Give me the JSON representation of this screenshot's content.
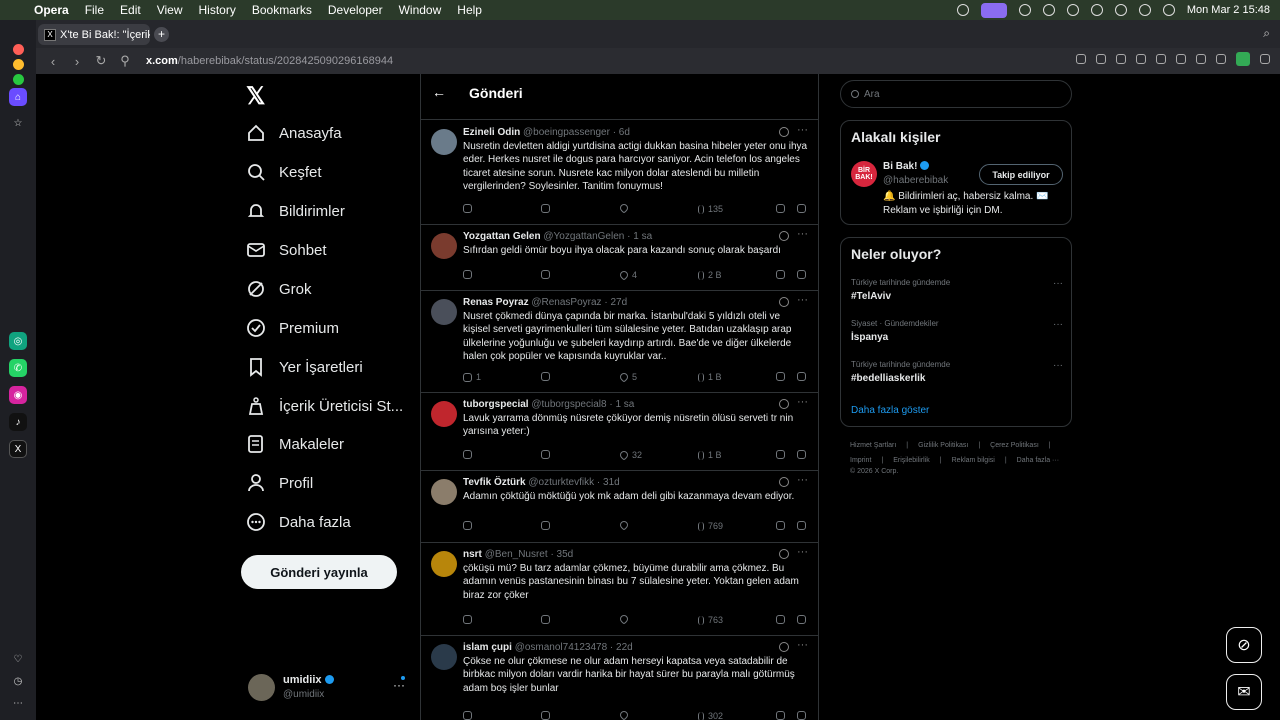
{
  "menubar": {
    "app": "Opera",
    "items": [
      "File",
      "Edit",
      "View",
      "History",
      "Bookmarks",
      "Developer",
      "Window",
      "Help"
    ],
    "datetime": "Mon Mar 2  15:48"
  },
  "browser": {
    "tab_title": "X'te Bi Bak!: \"İçerik Üret",
    "url_host": "x.com",
    "url_path": "/haberebibak/status/2028425090296168944"
  },
  "nav": {
    "items": [
      {
        "label": "Anasayfa",
        "icon": "home-icon"
      },
      {
        "label": "Keşfet",
        "icon": "search-icon"
      },
      {
        "label": "Bildirimler",
        "icon": "bell-icon"
      },
      {
        "label": "Sohbet",
        "icon": "mail-icon"
      },
      {
        "label": "Grok",
        "icon": "grok-icon"
      },
      {
        "label": "Premium",
        "icon": "verified-icon"
      },
      {
        "label": "Yer İşaretleri",
        "icon": "bookmark-icon"
      },
      {
        "label": "İçerik Üreticisi St...",
        "icon": "creator-icon"
      },
      {
        "label": "Makaleler",
        "icon": "article-icon"
      },
      {
        "label": "Profil",
        "icon": "profile-icon"
      },
      {
        "label": "Daha fazla",
        "icon": "more-circle-icon"
      }
    ],
    "post_button": "Gönderi yayınla",
    "account": {
      "name": "umidiix",
      "handle": "@umidiix"
    }
  },
  "feed": {
    "title": "Gönderi",
    "tweets": [
      {
        "name": "Ezineli Odin",
        "handle": "@boeingpassenger",
        "time": "· 6d",
        "avatar": "#6a7b8a",
        "text": "Nusretin devletten aldigi yurtdisina actigi dukkan basina hibeler yeter onu ihya eder. Herkes nusret ile dogus para harcıyor saniyor. Acin telefon los angeles ticaret atesine sorun. Nusrete kac milyon dolar ateslendi bu milletin vergilerinden? Soylesinler. Tanitim fonuymus!",
        "replies": "",
        "retweets": "",
        "likes": "",
        "views": "135"
      },
      {
        "name": "Yozgattan Gelen",
        "handle": "@YozgattanGelen",
        "time": "· 1 sa",
        "avatar": "#7a3b2e",
        "text": "Sıfırdan geldi ömür boyu ihya olacak para kazandı sonuç olarak başardı",
        "replies": "",
        "retweets": "",
        "likes": "4",
        "views": "2 B"
      },
      {
        "name": "Renas Poyraz",
        "handle": "@RenasPoyraz",
        "time": "· 27d",
        "avatar": "#4a4f5a",
        "text": "Nusret çökmedi dünya çapında bir marka. İstanbul'daki 5 yıldızlı oteli ve kişisel serveti gayrimenkulleri tüm sülalesine yeter. Batıdan uzaklaşıp arap ülkelerine yoğunluğu ve şubeleri kaydırıp artırdı. Bae'de ve diğer ülkelerde halen çok popüler ve kapısında kuyruklar var..",
        "replies": "1",
        "retweets": "",
        "likes": "5",
        "views": "1 B"
      },
      {
        "name": "tuborgspecial",
        "handle": "@tuborgspecial8",
        "time": "· 1 sa",
        "avatar": "#c0262d",
        "text": "Lavuk yarrama dönmüş nüsrete çöküyor demiş nüsretin ölüsü serveti tr nin yarısına yeter:)",
        "replies": "",
        "retweets": "",
        "likes": "32",
        "views": "1 B"
      },
      {
        "name": "Tevfik Öztürk",
        "handle": "@ozturktevfikk",
        "time": "· 31d",
        "avatar": "#8b7d6b",
        "text": "Adamın çöktüğü möktüğü yok mk adam deli gibi kazanmaya devam ediyor.",
        "replies": "",
        "retweets": "",
        "likes": "",
        "views": "769"
      },
      {
        "name": "nsrt",
        "handle": "@Ben_Nusret",
        "time": "· 35d",
        "avatar": "#b8860b",
        "text": "çöküşü mü? Bu tarz adamlar çökmez, büyüme durabilir ama çökmez. Bu adamın venüs pastanesinin binası bu 7 sülalesine yeter. Yoktan gelen adam biraz zor çöker",
        "replies": "",
        "retweets": "",
        "likes": "",
        "views": "763"
      },
      {
        "name": "islam çupi",
        "handle": "@osmanol74123478",
        "time": "· 22d",
        "avatar": "#2a3a4a",
        "text": "Çökse ne olur çökmese ne olur adam herseyi kapatsa veya satadabilir de birbkac milyon doları vardir harika bir hayat sürer bu parayla malı götürmüş adam boş işler bunlar",
        "replies": "",
        "retweets": "",
        "likes": "",
        "views": "302"
      }
    ]
  },
  "right": {
    "search_placeholder": "Ara",
    "related": {
      "title": "Alakalı kişiler",
      "name": "Bi Bak!",
      "handle": "@haberebibak",
      "follow": "Takip ediliyor",
      "bio": "🔔 Bildirimleri aç, habersiz kalma. ✉️ Reklam ve işbirliği için DM.",
      "logo": "BİR BAK!"
    },
    "trends": {
      "title": "Neler oluyor?",
      "items": [
        {
          "context": "Türkiye tarihinde gündemde",
          "tag": "#TelAviv"
        },
        {
          "context": "Siyaset · Gündemdekiler",
          "tag": "İspanya"
        },
        {
          "context": "Türkiye tarihinde gündemde",
          "tag": "#bedelliaskerlik"
        }
      ],
      "show_more": "Daha fazla göster"
    },
    "footer": {
      "line1": [
        "Hizmet Şartları",
        "|",
        "Gizlilik Politikası",
        "|",
        "Çerez Politikası",
        "|"
      ],
      "line2": [
        "Imprint",
        "|",
        "Erişilebilirlik",
        "|",
        "Reklam bilgisi",
        "|",
        "Daha fazla ···"
      ],
      "copyright": "© 2026 X Corp."
    }
  }
}
